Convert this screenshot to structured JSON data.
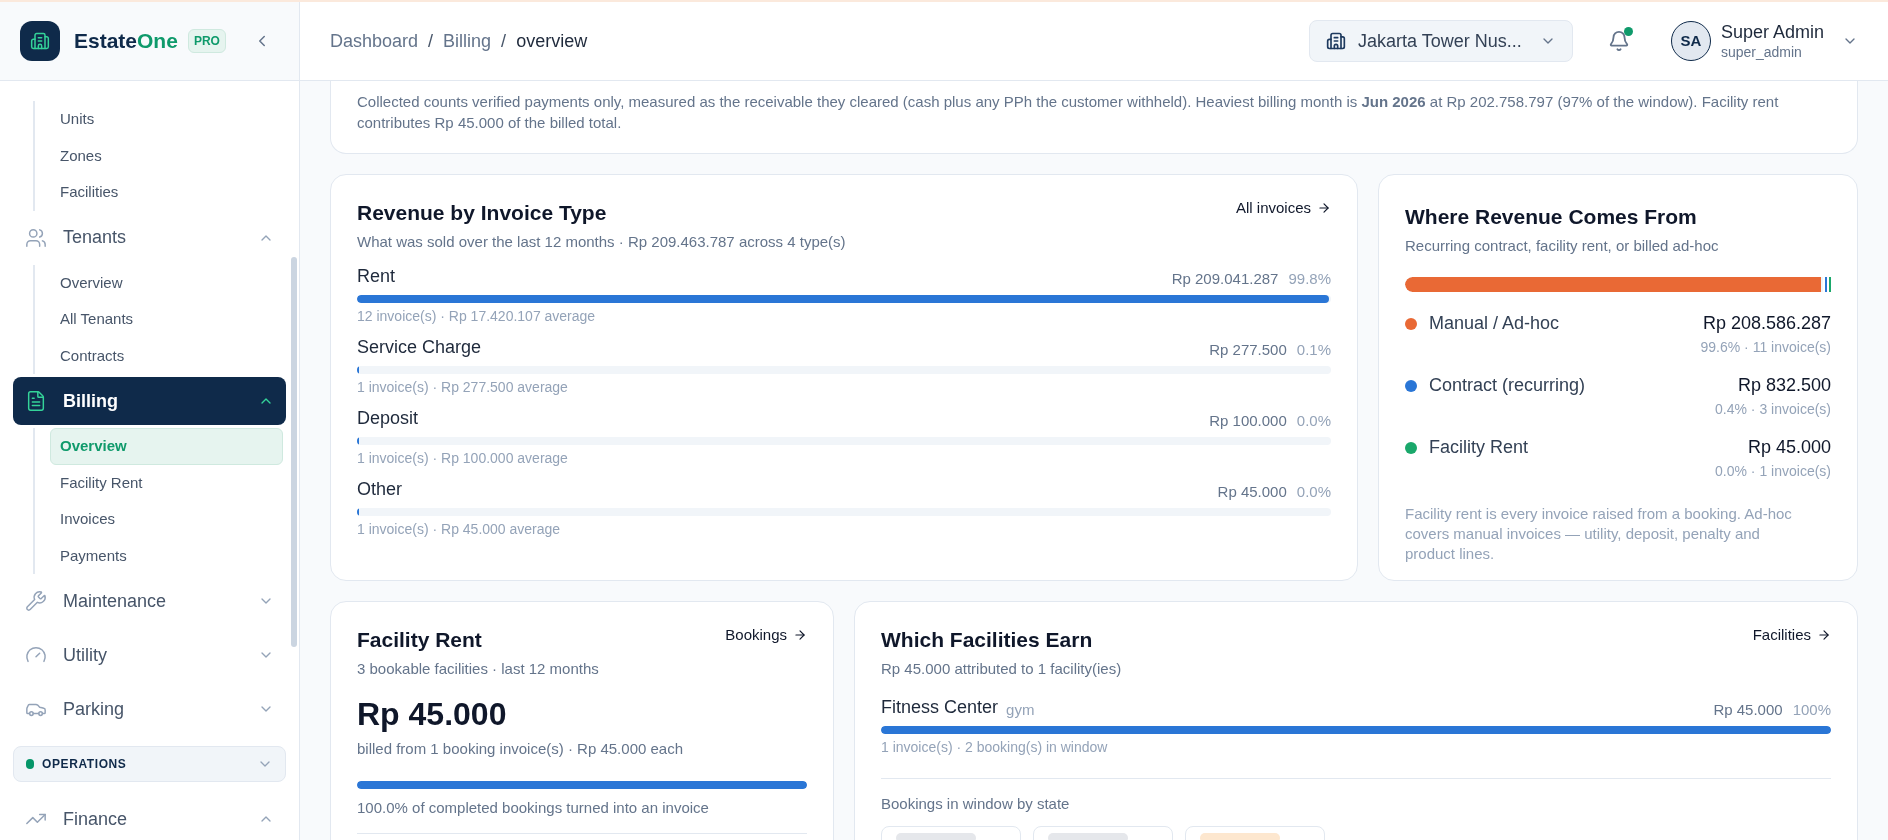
{
  "brand": {
    "name_start": "Estate",
    "name_end": "One",
    "badge": "PRO"
  },
  "sidebar": {
    "items": [
      {
        "kind": "sub",
        "label": "Units",
        "selected": false
      },
      {
        "kind": "sub",
        "label": "Zones",
        "selected": false
      },
      {
        "kind": "sub",
        "label": "Facilities",
        "selected": false
      },
      {
        "kind": "group",
        "label": "Tenants",
        "expanded": true,
        "selected": false
      },
      {
        "kind": "sub",
        "label": "Overview",
        "selected": false
      },
      {
        "kind": "sub",
        "label": "All Tenants",
        "selected": false
      },
      {
        "kind": "sub",
        "label": "Contracts",
        "selected": false
      },
      {
        "kind": "group",
        "label": "Billing",
        "expanded": true,
        "selected": true
      },
      {
        "kind": "sub",
        "label": "Overview",
        "selected": true
      },
      {
        "kind": "sub",
        "label": "Facility Rent",
        "selected": false
      },
      {
        "kind": "sub",
        "label": "Invoices",
        "selected": false
      },
      {
        "kind": "sub",
        "label": "Payments",
        "selected": false
      },
      {
        "kind": "group",
        "label": "Maintenance",
        "expanded": false,
        "selected": false
      },
      {
        "kind": "group",
        "label": "Utility",
        "expanded": false,
        "selected": false
      },
      {
        "kind": "group",
        "label": "Parking",
        "expanded": false,
        "selected": false
      },
      {
        "kind": "section",
        "label": "OPERATIONS",
        "color": "#059669"
      },
      {
        "kind": "group",
        "label": "Finance",
        "expanded": true,
        "selected": false
      }
    ]
  },
  "breadcrumb": {
    "separator": "/",
    "items": [
      "Dashboard",
      "Billing",
      "overview"
    ]
  },
  "property_selector": {
    "value": "Jakarta Tower Nus..."
  },
  "notifications": {
    "unread": true
  },
  "user": {
    "initials": "SA",
    "name": "Super Admin",
    "role": "super_admin"
  },
  "summary": "Collected counts verified payments only, measured as the receivable they cleared (cash plus any PPh the customer withheld). Heaviest billing month is **Jun 2026** at Rp 202.758.797 (97% of the window). Facility rent contributes Rp 45.000 of the billed total.",
  "revenue_by_type": {
    "title": "Revenue by Invoice Type",
    "link": "All invoices",
    "subtitle": "What was sold over the last 12 months · Rp 209.463.787 across 4 type(s)",
    "rows": [
      {
        "label": "Rent",
        "amount": "Rp 209.041.287",
        "share": "99.8%",
        "level": 0.998,
        "note": "12 invoice(s) · Rp 17.420.107 average"
      },
      {
        "label": "Service Charge",
        "amount": "Rp 277.500",
        "share": "0.1%",
        "level": 0.001,
        "note": "1 invoice(s) · Rp 277.500 average"
      },
      {
        "label": "Deposit",
        "amount": "Rp 100.000",
        "share": "0.0%",
        "level": 0.0005,
        "note": "1 invoice(s) · Rp 100.000 average"
      },
      {
        "label": "Other",
        "amount": "Rp 45.000",
        "share": "0.0%",
        "level": 0.0002,
        "note": "1 invoice(s) · Rp 45.000 average"
      }
    ]
  },
  "revenue_sources": {
    "title": "Where Revenue Comes From",
    "subtitle": "Recurring contract, facility rent, or billed ad-hoc",
    "items": [
      {
        "label": "Manual / Ad-hoc",
        "amount": "Rp 208.586.287",
        "detail": "99.6% · 11 invoice(s)",
        "color": "#e96935",
        "level": 0.996
      },
      {
        "label": "Contract (recurring)",
        "amount": "Rp 832.500",
        "detail": "0.4% · 3 invoice(s)",
        "color": "#2a76d6"
      },
      {
        "label": "Facility Rent",
        "amount": "Rp 45.000",
        "detail": "0.0% · 1 invoice(s)",
        "color": "#1aa86b"
      }
    ],
    "footnote": "Facility rent is every invoice raised from a booking. Ad-hoc covers manual invoices — utility, deposit, penalty and product lines."
  },
  "facility_rent": {
    "title": "Facility Rent",
    "link": "Bookings",
    "subtitle": "3 bookable facilities · last 12 months",
    "total": "Rp 45.000",
    "total_note": "billed from 1 booking invoice(s) · Rp 45.000 each",
    "level": 1.0,
    "conversion": "100.0% of completed bookings turned into an invoice"
  },
  "facilities_earn": {
    "title": "Which Facilities Earn",
    "link": "Facilities",
    "subtitle": "Rp 45.000 attributed to 1 facility(ies)",
    "rows": [
      {
        "name": "Fitness Center",
        "tag": "gym",
        "amount": "Rp 45.000",
        "share": "100%",
        "level": 1.0,
        "note": "1 invoice(s) · 2 booking(s) in window"
      }
    ],
    "states_title": "Bookings in window by state"
  }
}
